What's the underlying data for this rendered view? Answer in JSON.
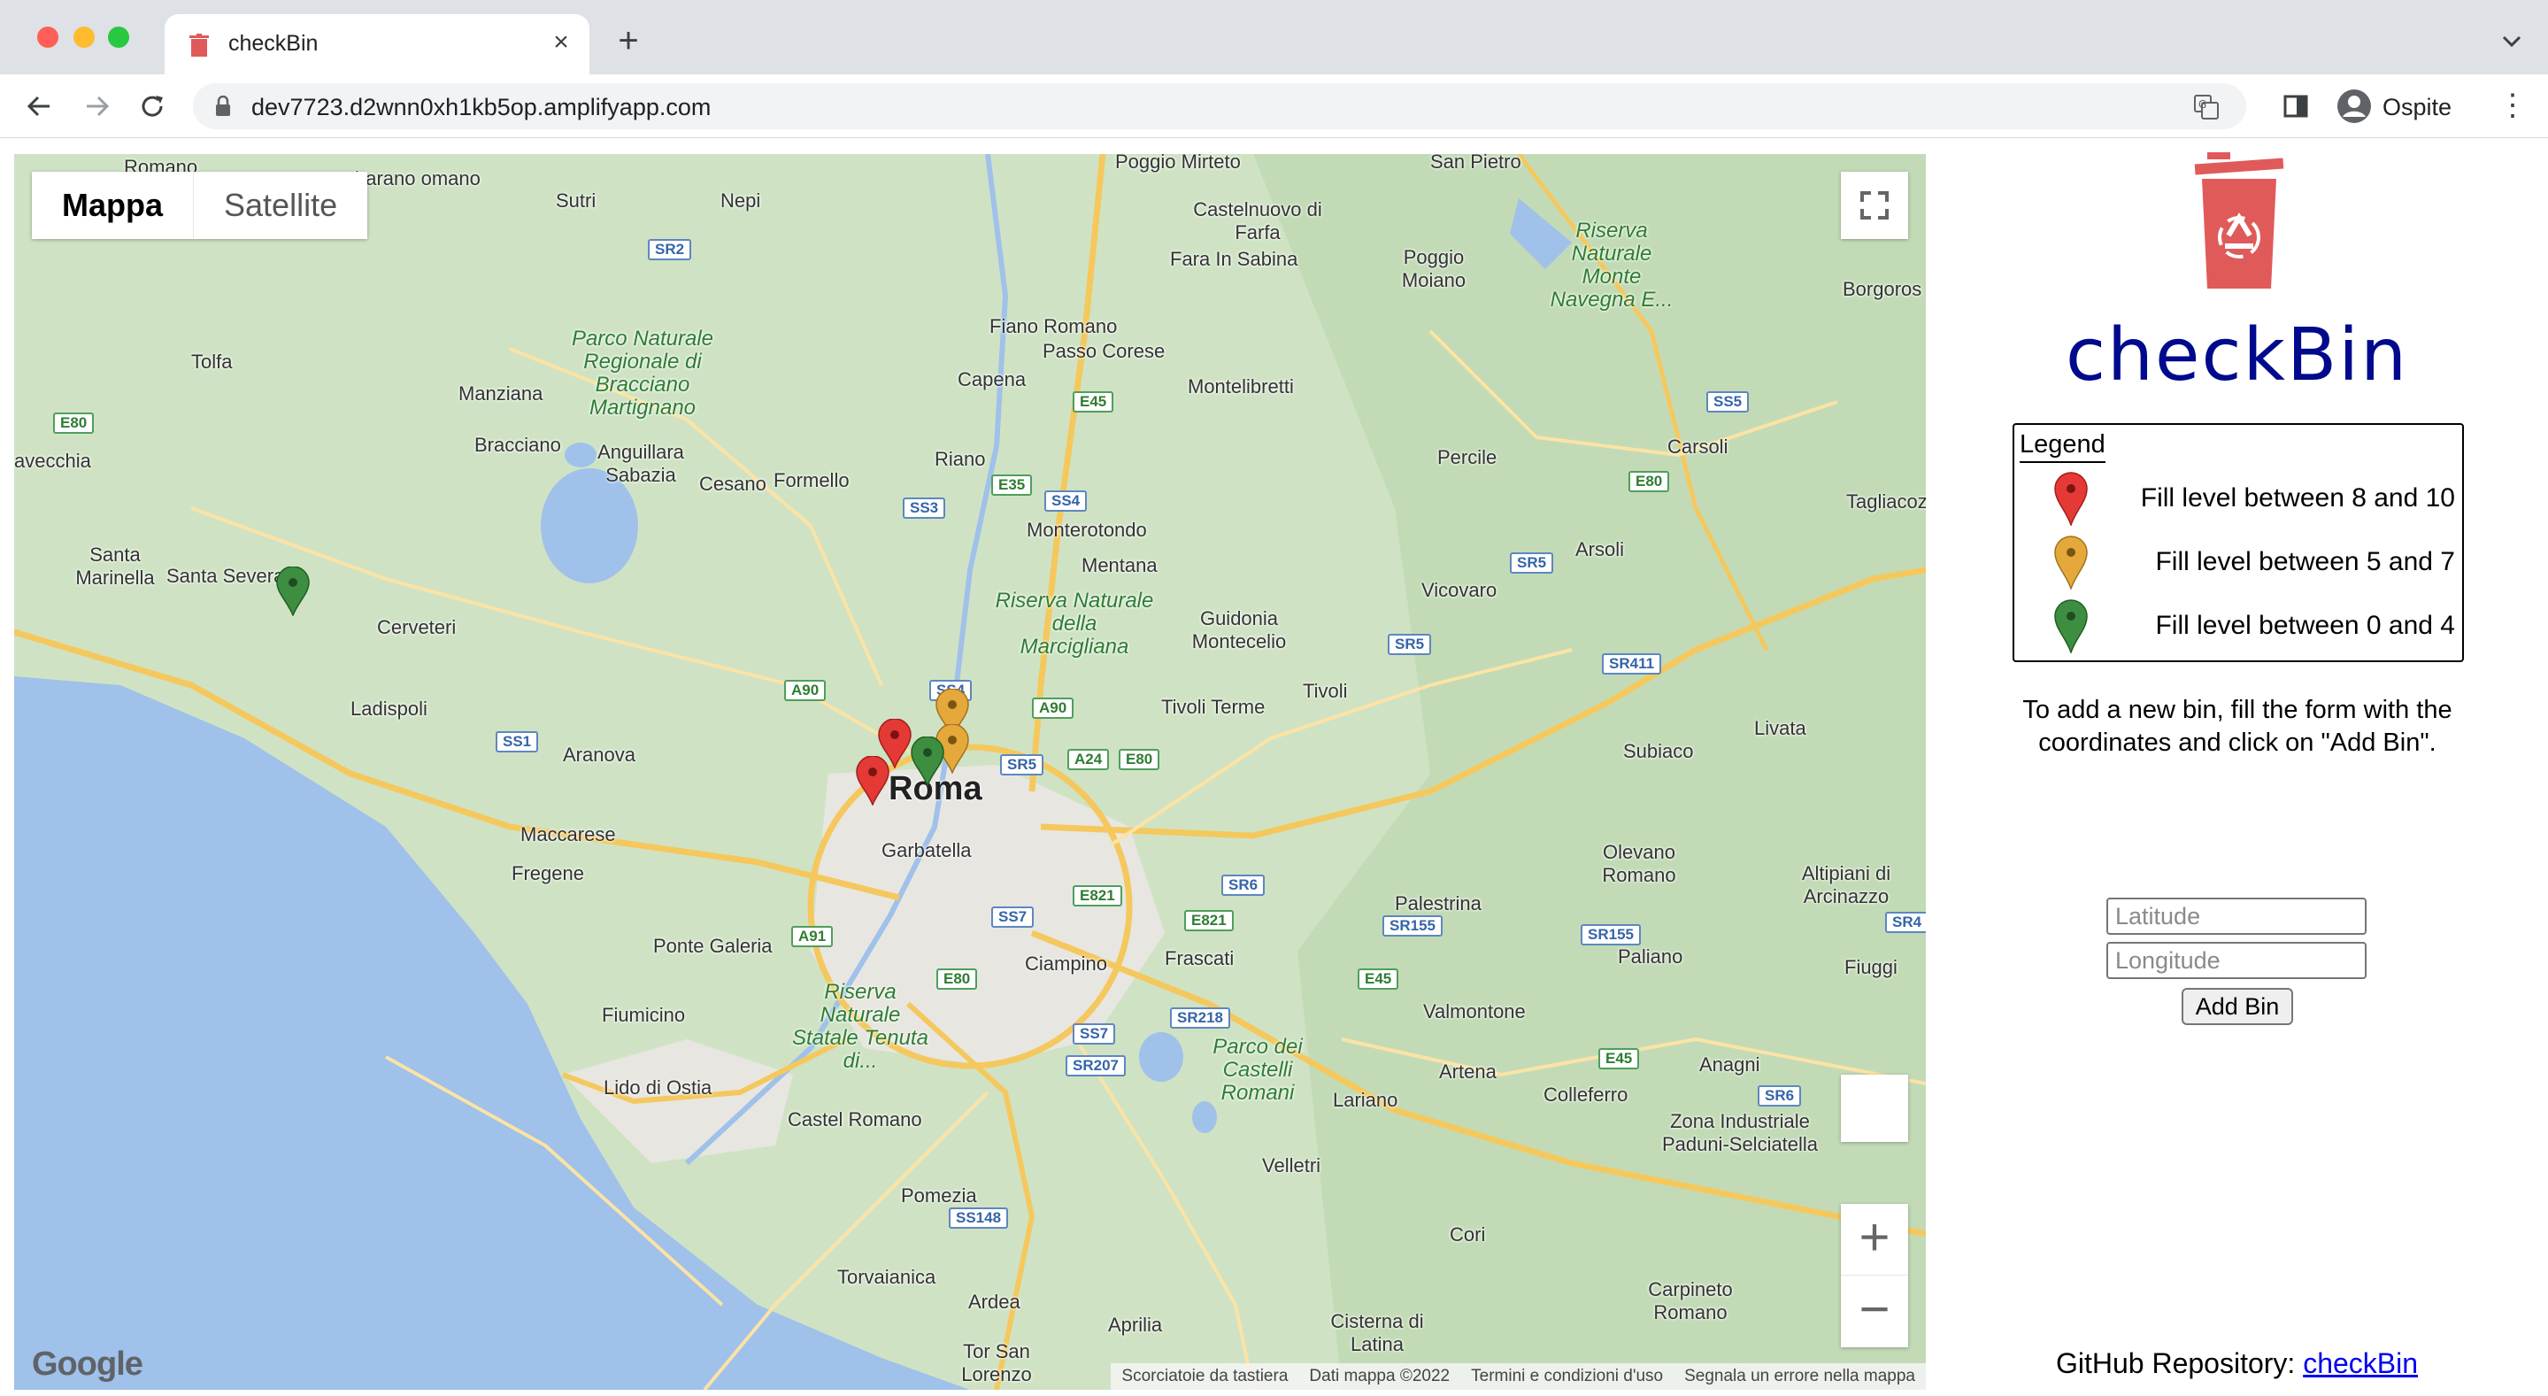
{
  "browser": {
    "tab_title": "checkBin",
    "url": "dev7723.d2wnn0xh1kb5op.amplifyapp.com",
    "profile_name": "Ospite",
    "new_tab_glyph": "+",
    "close_glyph": "×",
    "menu_glyph": "⋮"
  },
  "map": {
    "type_buttons": [
      "Mappa",
      "Satellite"
    ],
    "google_logo": "Google",
    "attribution": [
      "Scorciatoie da tastiera",
      "Dati mappa ©2022",
      "Termini e condizioni d'uso",
      "Segnala un errore nella mappa"
    ],
    "zoom_in": "+",
    "zoom_out": "−",
    "places": {
      "roma": "Roma",
      "garbatella": "Garbatella",
      "sutri": "Sutri",
      "nepi": "Nepi",
      "tolfa": "Tolfa",
      "manziana": "Manziana",
      "bracciano": "Bracciano",
      "anguillara": "Anguillara Sabazia",
      "cesano": "Cesano",
      "formello": "Formello",
      "cerveteri": "Cerveteri",
      "ladispoli": "Ladispoli",
      "aranova": "Aranova",
      "maccarese": "Maccarese",
      "fregene": "Fregene",
      "ponte_galeria": "Ponte Galeria",
      "fiumicino": "Fiumicino",
      "lido_ostia": "Lido di Ostia",
      "castel_romano": "Castel Romano",
      "pomezia": "Pomezia",
      "torvaianica": "Torvaianica",
      "ardea": "Ardea",
      "aprilia": "Aprilia",
      "tor_san_lorenzo": "Tor San Lorenzo",
      "santa_marinella": "Santa Marinella",
      "santa_severa": "Santa Severa",
      "civitavecchia": "avecchia",
      "riano": "Riano",
      "capena": "Capena",
      "fiano_romano": "Fiano Romano",
      "passo_corese": "Passo Corese",
      "monterotondo": "Monterotondo",
      "mentana": "Mentana",
      "montelibretti": "Montelibretti",
      "guidonia": "Guidonia Montecelio",
      "tivoli": "Tivoli",
      "tivoli_terme": "Tivoli Terme",
      "vicovaro": "Vicovaro",
      "percile": "Percile",
      "carsoli": "Carsoli",
      "arsoli": "Arsoli",
      "tagliacozzo": "Tagliacoz",
      "livata": "Livata",
      "subiaco": "Subiaco",
      "olevano": "Olevano Romano",
      "palestrina": "Palestrina",
      "altipiani": "Altipiani di Arcinazzo",
      "frascati": "Frascati",
      "ciampino": "Ciampino",
      "valmontone": "Valmontone",
      "paliano": "Paliano",
      "fiuggi": "Fiuggi",
      "anagni": "Anagni",
      "colleferro": "Colleferro",
      "artena": "Artena",
      "lariano": "Lariano",
      "velletri": "Velletri",
      "cori": "Cori",
      "cisterna": "Cisterna di Latina",
      "carpineto": "Carpineto Romano",
      "zona_ind": "Zona Industriale Paduni-Selciatella",
      "castelnuovo": "Castelnuovo di Farfa",
      "fara": "Fara In Sabina",
      "poggio_moiano": "Poggio Moiano",
      "poggio_mirteto": "Poggio Mirteto",
      "borgorose": "Borgoros",
      "san_pietro": "San Pietro",
      "romano": "Romano",
      "barbarano": "barano omano",
      "park_bracciano": "Parco Naturale Regionale di Bracciano Martignano",
      "park_marcigliana": "Riserva Naturale della Marcigliana",
      "park_litorale": "Riserva Naturale Statale Tenuta di...",
      "park_castelli": "Parco dei Castelli Romani",
      "park_navegna": "Riserva Naturale Monte Navegna E..."
    },
    "roads": [
      "SR2",
      "E80",
      "E45",
      "SS4",
      "SS3",
      "E35",
      "A90",
      "SS1",
      "SS4",
      "A90",
      "SR5",
      "A24",
      "E80",
      "E821",
      "SR6",
      "SS7",
      "E80",
      "A91",
      "E821",
      "SS7",
      "SR218",
      "SR207",
      "SS148",
      "SR155",
      "E45",
      "SR155",
      "E45",
      "SR6",
      "SS5",
      "E80",
      "SR5",
      "SR5",
      "SR411",
      "SR4"
    ],
    "markers": [
      {
        "level": "green",
        "color": "#3e8e41"
      },
      {
        "level": "red",
        "color": "#e53935"
      },
      {
        "level": "orange",
        "color": "#e5a83a"
      },
      {
        "level": "orange",
        "color": "#e5a83a"
      },
      {
        "level": "green",
        "color": "#3e8e41"
      },
      {
        "level": "red",
        "color": "#e53935"
      }
    ]
  },
  "app": {
    "brand": "checkBin",
    "logo_color": "#e05a5a",
    "brand_color": "#000a8c",
    "legend": {
      "title": "Legend",
      "items": [
        {
          "label": "Fill level between 8 and 10",
          "color": "#e53935"
        },
        {
          "label": "Fill level between 5 and 7",
          "color": "#e5a83a"
        },
        {
          "label": "Fill level between 0 and 4",
          "color": "#3e8e41"
        }
      ]
    },
    "instructions": "To add a new bin, fill the form with the coordinates and click on \"Add Bin\".",
    "latitude_placeholder": "Latitude",
    "longitude_placeholder": "Longitude",
    "add_button": "Add Bin",
    "github_label": "GitHub Repository:",
    "github_link": "checkBin"
  }
}
